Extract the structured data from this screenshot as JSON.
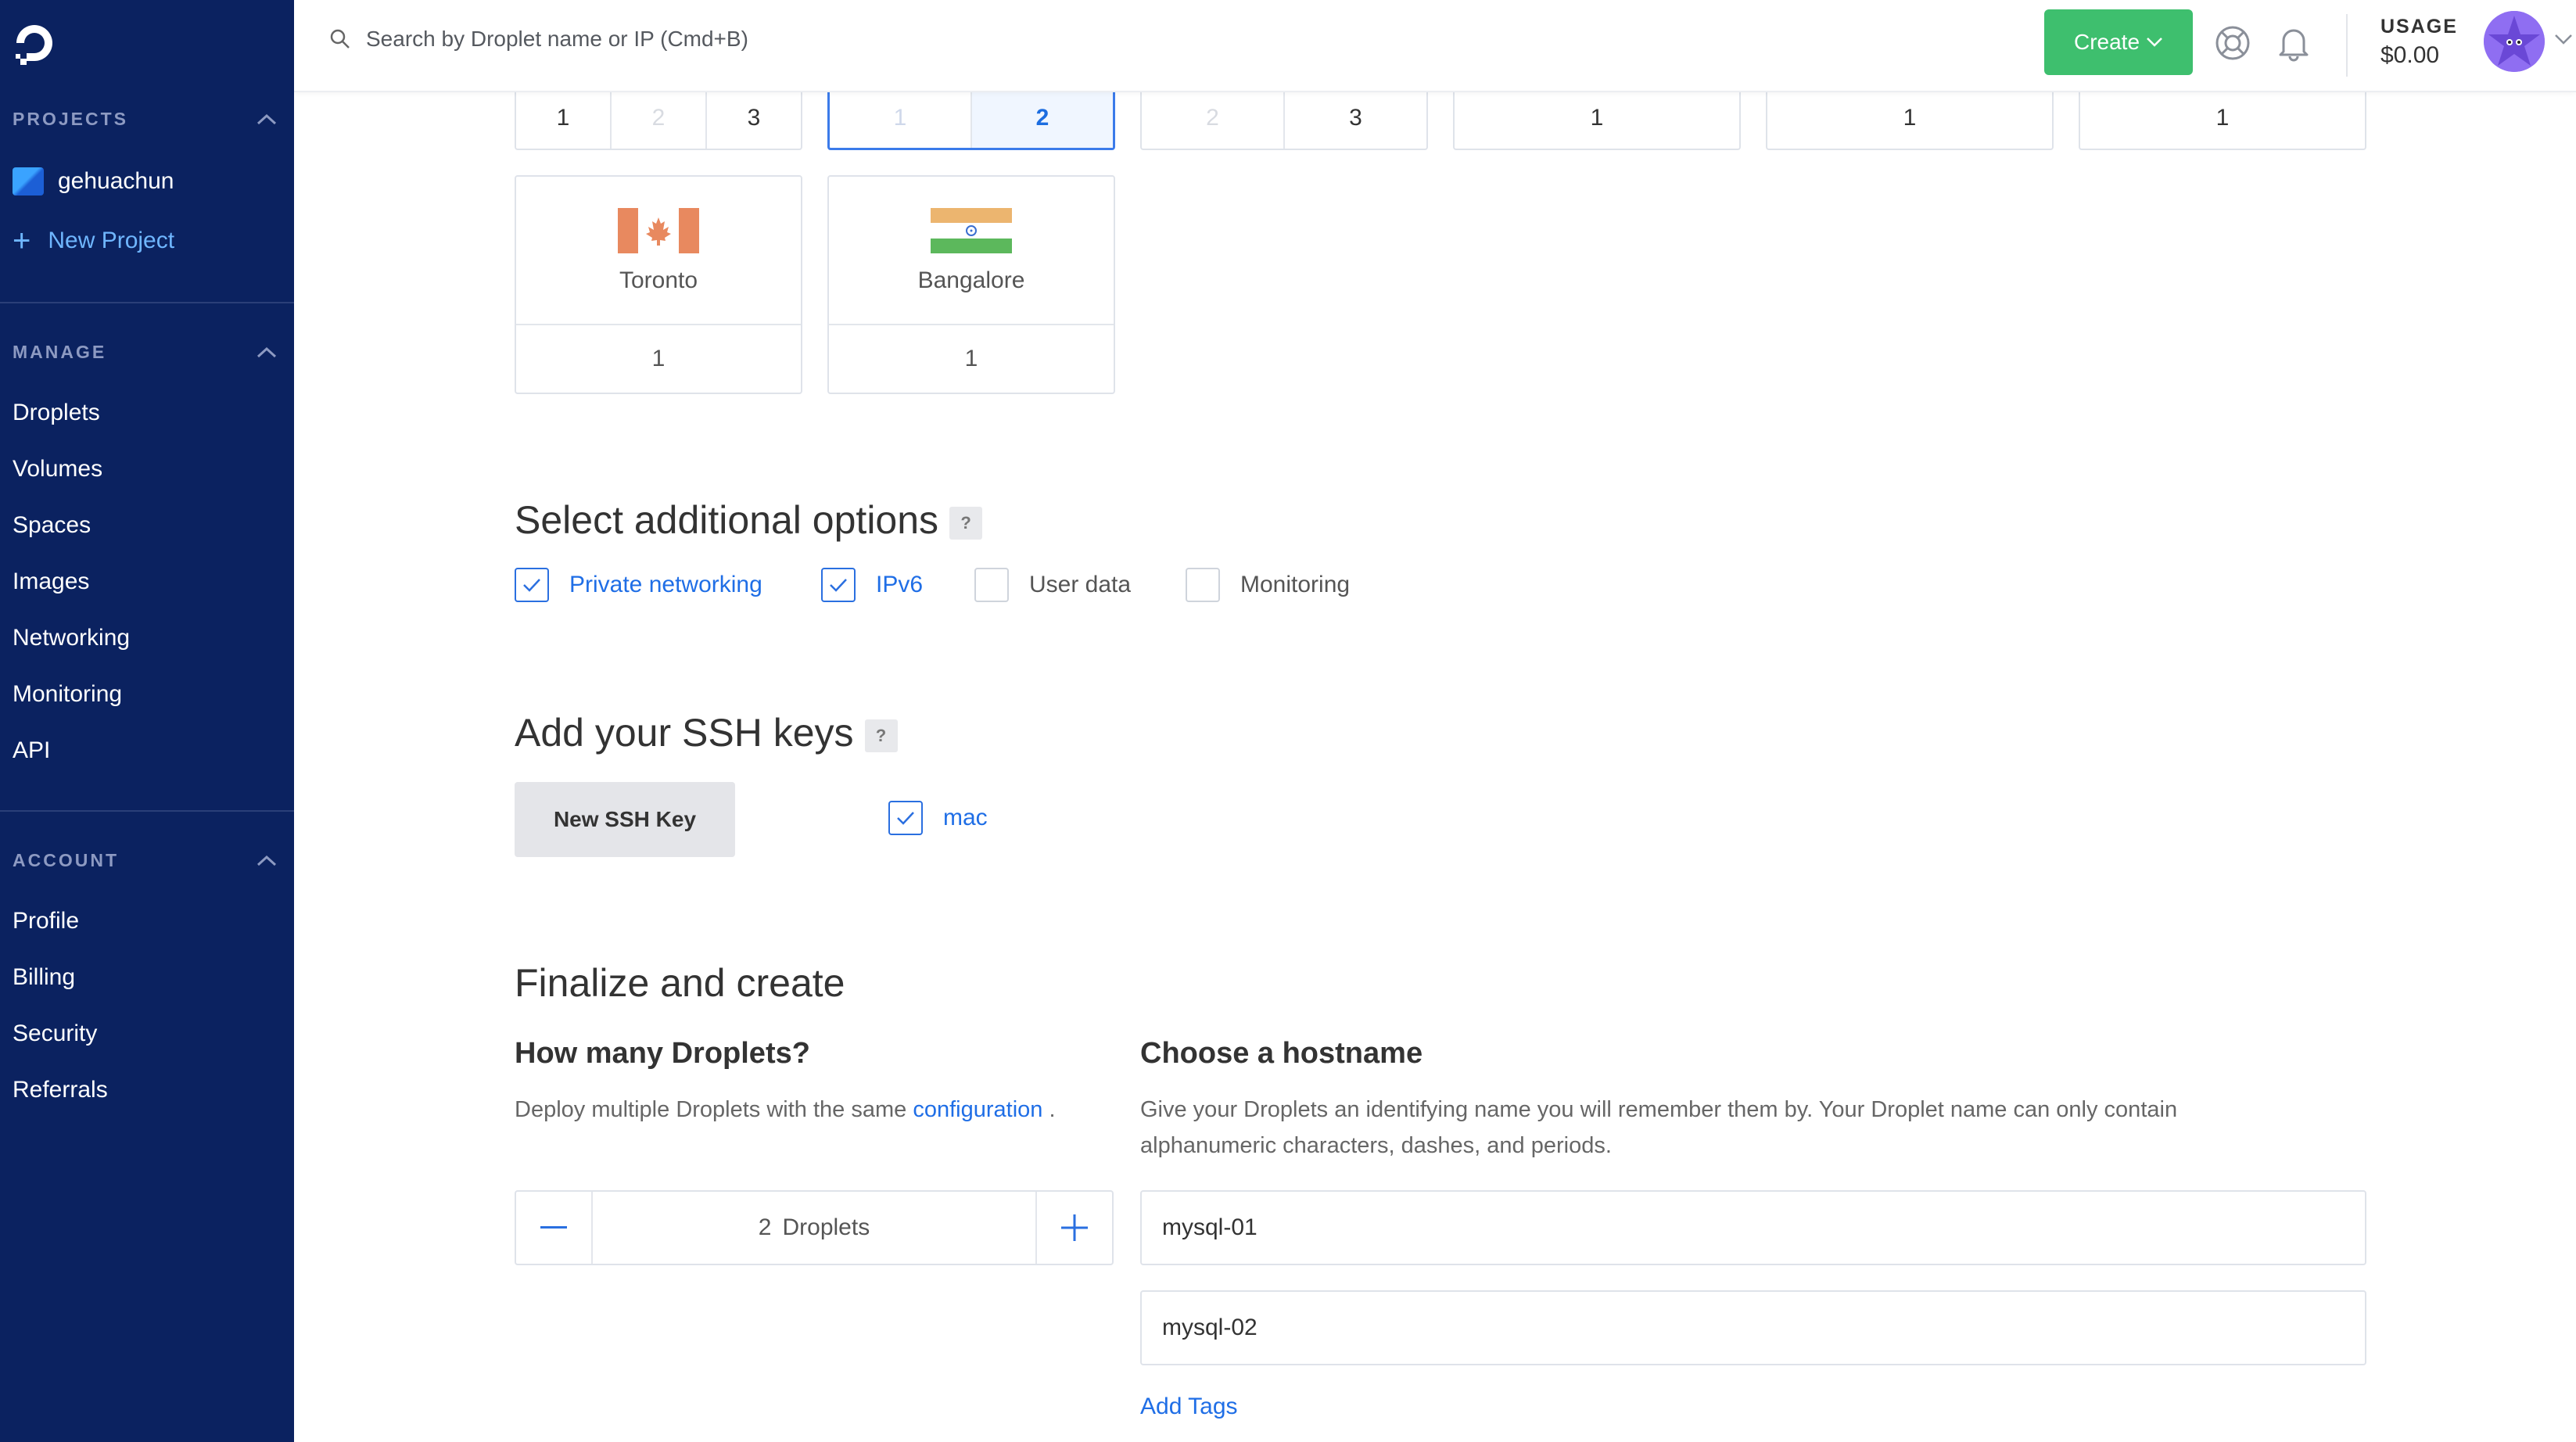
{
  "sidebar": {
    "projects_heading": "PROJECTS",
    "project_name": "gehuachun",
    "new_project_label": "New Project",
    "manage_heading": "MANAGE",
    "manage_items": [
      "Droplets",
      "Volumes",
      "Spaces",
      "Images",
      "Networking",
      "Monitoring",
      "API"
    ],
    "account_heading": "ACCOUNT",
    "account_items": [
      "Profile",
      "Billing",
      "Security",
      "Referrals"
    ]
  },
  "topbar": {
    "search_placeholder": "Search by Droplet name or IP (Cmd+B)",
    "create_label": "Create",
    "usage_label": "USAGE",
    "usage_value": "$0.00"
  },
  "datacenter": {
    "top_row_groups": [
      {
        "options": [
          "1",
          "2",
          "3"
        ],
        "disabled": [
          false,
          true,
          false
        ],
        "selected": false
      },
      {
        "options": [
          "1",
          "2"
        ],
        "active_option": "2",
        "selected": true
      },
      {
        "options": [
          "2",
          "3"
        ],
        "disabled": [
          true,
          false
        ],
        "selected": false
      },
      {
        "options": [
          "1"
        ],
        "selected": false
      },
      {
        "options": [
          "1"
        ],
        "selected": false
      },
      {
        "options": [
          "1"
        ],
        "selected": false
      }
    ],
    "regions": [
      {
        "name": "Toronto",
        "count": "1",
        "flag": "canada-flag-icon"
      },
      {
        "name": "Bangalore",
        "count": "1",
        "flag": "india-flag-icon"
      }
    ]
  },
  "additional_options": {
    "title": "Select additional options",
    "help": "?",
    "options": [
      {
        "label": "Private networking",
        "checked": true
      },
      {
        "label": "IPv6",
        "checked": true
      },
      {
        "label": "User data",
        "checked": false
      },
      {
        "label": "Monitoring",
        "checked": false
      }
    ]
  },
  "ssh": {
    "title": "Add your SSH keys",
    "help": "?",
    "new_key_label": "New SSH Key",
    "key_name": "mac",
    "key_checked": true
  },
  "finalize": {
    "title": "Finalize and create",
    "droplets_heading": "How many Droplets?",
    "droplets_desc_prefix": "Deploy multiple Droplets with the same",
    "droplets_desc_link": "configuration",
    "droplets_desc_suffix": ".",
    "droplet_count": "2",
    "droplet_unit": "Droplets",
    "hostname_heading": "Choose a hostname",
    "hostname_desc_line1": "Give your Droplets an identifying name you will remember them by. Your Droplet name can only contain",
    "hostname_desc_line2": "alphanumeric characters, dashes, and periods.",
    "hostnames": [
      "mysql-01",
      "mysql-02"
    ],
    "add_tags_label": "Add Tags"
  },
  "colors": {
    "sidebar_bg": "#0b2260",
    "accent_blue": "#1f6ee6",
    "create_green": "#3ebf6e"
  }
}
